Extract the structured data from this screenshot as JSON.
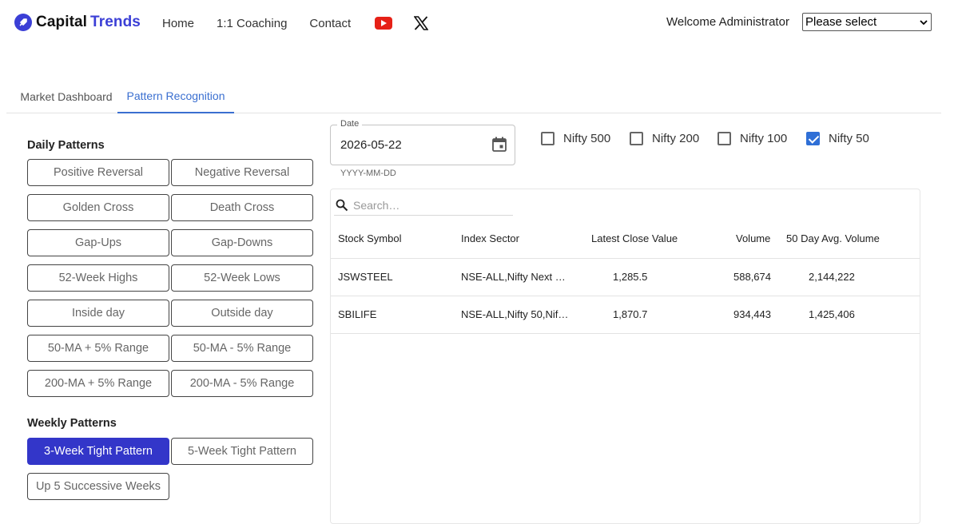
{
  "header": {
    "brand_part1": "Capital",
    "brand_part2": "Trends",
    "nav": [
      "Home",
      "1:1 Coaching",
      "Contact"
    ],
    "welcome": "Welcome Administrator",
    "select_value": "Please select"
  },
  "tabs": [
    {
      "label": "Market Dashboard",
      "active": false
    },
    {
      "label": "Pattern Recognition",
      "active": true
    }
  ],
  "daily": {
    "title": "Daily Patterns",
    "buttons": [
      "Positive Reversal",
      "Negative Reversal",
      "Golden Cross",
      "Death Cross",
      "Gap-Ups",
      "Gap-Downs",
      "52-Week Highs",
      "52-Week Lows",
      "Inside day",
      "Outside day",
      "50-MA + 5% Range",
      "50-MA - 5% Range",
      "200-MA + 5% Range",
      "200-MA - 5% Range"
    ]
  },
  "weekly": {
    "title": "Weekly Patterns",
    "buttons": [
      "3-Week Tight Pattern",
      "5-Week Tight Pattern",
      "Up 5 Successive Weeks"
    ],
    "selected": "3-Week Tight Pattern"
  },
  "date": {
    "label": "Date",
    "value": "2026-05-22",
    "helper": "YYYY-MM-DD"
  },
  "indices": [
    {
      "label": "Nifty 500",
      "checked": false
    },
    {
      "label": "Nifty 200",
      "checked": false
    },
    {
      "label": "Nifty 100",
      "checked": false
    },
    {
      "label": "Nifty 50",
      "checked": true
    }
  ],
  "table": {
    "search_placeholder": "Search…",
    "columns": [
      "Stock Symbol",
      "Index Sector",
      "Latest Close Value",
      "Volume",
      "50 Day Avg. Volume"
    ],
    "rows": [
      [
        "JSWSTEEL",
        "NSE-ALL,Nifty Next …",
        "1,285.5",
        "588,674",
        "2,144,222"
      ],
      [
        "SBILIFE",
        "NSE-ALL,Nifty 50,Nif…",
        "1,870.7",
        "934,443",
        "1,425,406"
      ]
    ]
  },
  "colors": {
    "brand": "#3b3fd6",
    "tab_active": "#3a6fd0",
    "selected_button": "#3336c9",
    "checkbox": "#2f6fd6"
  }
}
